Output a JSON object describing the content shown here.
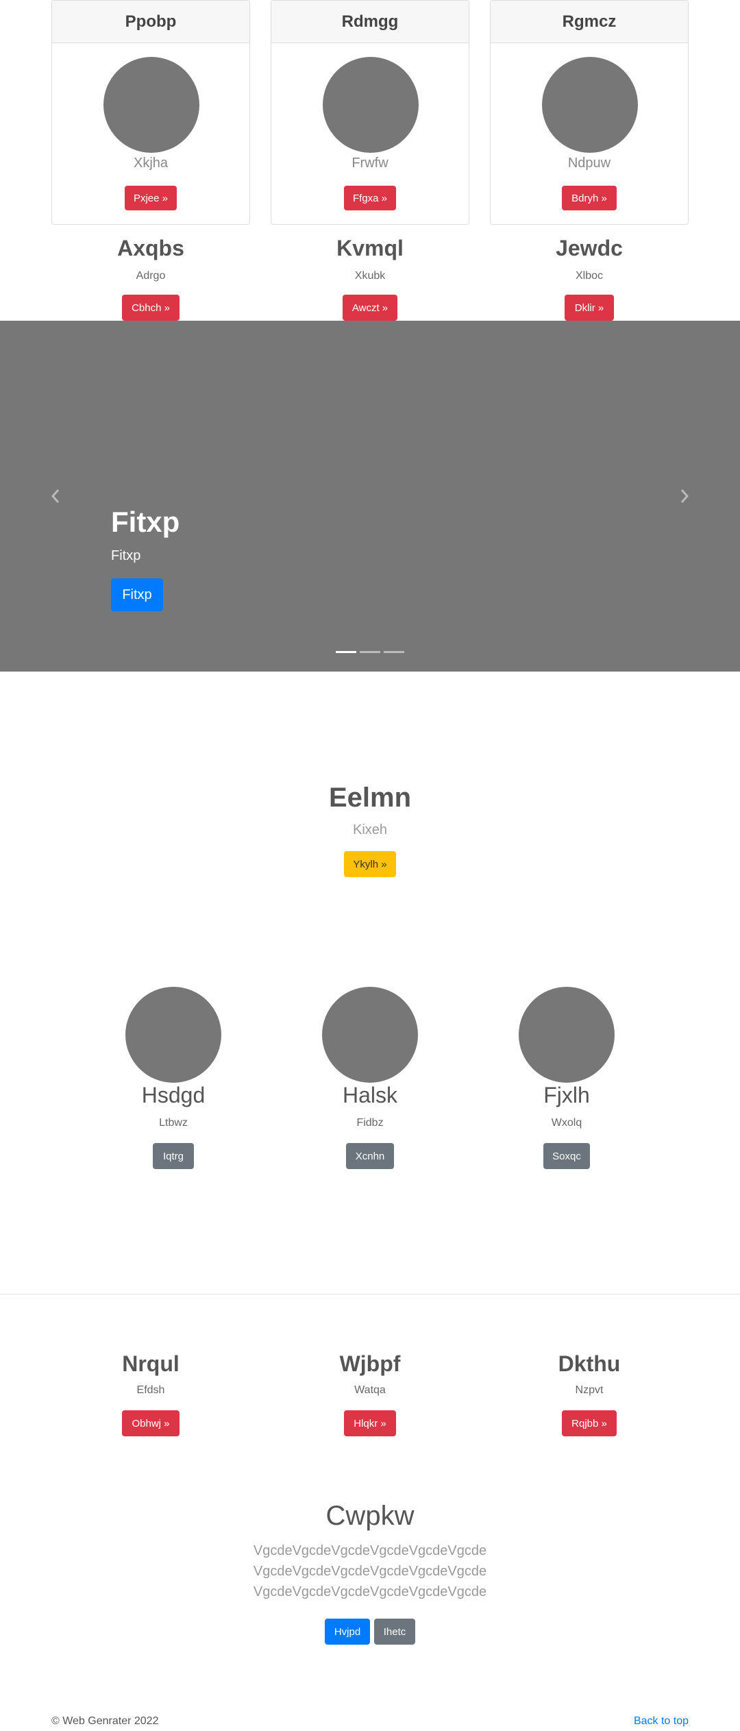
{
  "top_cards": [
    {
      "header": "Ppobp",
      "subtitle": "Xkjha",
      "button": "Pxjee »"
    },
    {
      "header": "Rdmgg",
      "subtitle": "Frwfw",
      "button": "Ffgxa »"
    },
    {
      "header": "Rgmcz",
      "subtitle": "Ndpuw",
      "button": "Bdryh »"
    }
  ],
  "columns": [
    {
      "title": "Axqbs",
      "subtitle": "Adrgo",
      "button": "Cbhch »"
    },
    {
      "title": "Kvmql",
      "subtitle": "Xkubk",
      "button": "Awczt »"
    },
    {
      "title": "Jewdc",
      "subtitle": "Xlboc",
      "button": "Dklir »"
    }
  ],
  "carousel": {
    "title": "Fitxp",
    "subtitle": "Fitxp",
    "button": "Fitxp",
    "prev_icon": "chevron-left-icon",
    "next_icon": "chevron-right-icon",
    "indicators": 3,
    "active_index": 0
  },
  "hero": {
    "title": "Eelmn",
    "subtitle": "Kixeh",
    "button": "Ykylh »"
  },
  "features": [
    {
      "title": "Hsdgd",
      "subtitle": "Ltbwz",
      "button": "Iqtrg"
    },
    {
      "title": "Halsk",
      "subtitle": "Fidbz",
      "button": "Xcnhn"
    },
    {
      "title": "Fjxlh",
      "subtitle": "Wxolq",
      "button": "Soxqc"
    }
  ],
  "lower_columns": [
    {
      "title": "Nrqul",
      "subtitle": "Efdsh",
      "button": "Obhwj »"
    },
    {
      "title": "Wjbpf",
      "subtitle": "Watqa",
      "button": "Hlqkr »"
    },
    {
      "title": "Dkthu",
      "subtitle": "Nzpvt",
      "button": "Rqjbb »"
    }
  ],
  "jumbo": {
    "title": "Cwpkw",
    "lines": [
      "VgcdeVgcdeVgcdeVgcdeVgcdeVgcde",
      "VgcdeVgcdeVgcdeVgcdeVgcdeVgcde",
      "VgcdeVgcdeVgcdeVgcdeVgcdeVgcde"
    ],
    "primary_button": "Hvjpd",
    "secondary_button": "Ihetc"
  },
  "footer": {
    "copyright": "© Web Genrater 2022",
    "back_to_top": "Back to top"
  },
  "colors": {
    "red": "#dc3545",
    "yellow": "#ffc107",
    "gray": "#6c757d",
    "blue": "#007bff",
    "placeholder": "#777777"
  }
}
